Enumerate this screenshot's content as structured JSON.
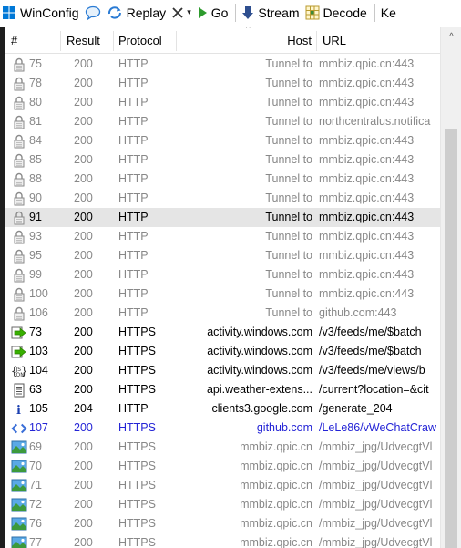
{
  "toolbar": {
    "items": [
      {
        "label": "WinConfig",
        "icon": "windows-logo-icon"
      },
      {
        "label": "",
        "icon": "comment-bubble-icon"
      },
      {
        "label": "Replay",
        "icon": "replay-arrows-icon"
      },
      {
        "label": "",
        "icon": "remove-x-icon",
        "dropdown": "▾"
      },
      {
        "label": "Go",
        "icon": "go-play-icon"
      },
      {
        "label": "Stream",
        "icon": "stream-down-arrow-icon"
      },
      {
        "label": "Decode",
        "icon": "decode-grid-icon"
      },
      {
        "label": "Ke",
        "icon": ""
      }
    ]
  },
  "columns": {
    "num": "#",
    "result": "Result",
    "protocol": "Protocol",
    "host": "Host",
    "url": "URL",
    "sort_indicator": "^"
  },
  "scrollbar": {
    "up_arrow": "^"
  },
  "colors": {
    "gray_text": "#888888",
    "blue_text": "#2424d6",
    "selected_row_bg": "#e5e5e5",
    "left_border": "#1e1e1e"
  },
  "rows": [
    {
      "icon": "lock-icon",
      "num": "75",
      "result": "200",
      "protocol": "HTTP",
      "host": "Tunnel to",
      "url": "mmbiz.qpic.cn:443",
      "style": "gray"
    },
    {
      "icon": "lock-icon",
      "num": "78",
      "result": "200",
      "protocol": "HTTP",
      "host": "Tunnel to",
      "url": "mmbiz.qpic.cn:443",
      "style": "gray"
    },
    {
      "icon": "lock-icon",
      "num": "80",
      "result": "200",
      "protocol": "HTTP",
      "host": "Tunnel to",
      "url": "mmbiz.qpic.cn:443",
      "style": "gray"
    },
    {
      "icon": "lock-icon",
      "num": "81",
      "result": "200",
      "protocol": "HTTP",
      "host": "Tunnel to",
      "url": "northcentralus.notifica",
      "style": "gray"
    },
    {
      "icon": "lock-icon",
      "num": "84",
      "result": "200",
      "protocol": "HTTP",
      "host": "Tunnel to",
      "url": "mmbiz.qpic.cn:443",
      "style": "gray"
    },
    {
      "icon": "lock-icon",
      "num": "85",
      "result": "200",
      "protocol": "HTTP",
      "host": "Tunnel to",
      "url": "mmbiz.qpic.cn:443",
      "style": "gray"
    },
    {
      "icon": "lock-icon",
      "num": "88",
      "result": "200",
      "protocol": "HTTP",
      "host": "Tunnel to",
      "url": "mmbiz.qpic.cn:443",
      "style": "gray"
    },
    {
      "icon": "lock-icon",
      "num": "90",
      "result": "200",
      "protocol": "HTTP",
      "host": "Tunnel to",
      "url": "mmbiz.qpic.cn:443",
      "style": "gray"
    },
    {
      "icon": "lock-icon",
      "num": "91",
      "result": "200",
      "protocol": "HTTP",
      "host": "Tunnel to",
      "url": "mmbiz.qpic.cn:443",
      "style": "black",
      "selected": true
    },
    {
      "icon": "lock-icon",
      "num": "93",
      "result": "200",
      "protocol": "HTTP",
      "host": "Tunnel to",
      "url": "mmbiz.qpic.cn:443",
      "style": "gray"
    },
    {
      "icon": "lock-icon",
      "num": "95",
      "result": "200",
      "protocol": "HTTP",
      "host": "Tunnel to",
      "url": "mmbiz.qpic.cn:443",
      "style": "gray"
    },
    {
      "icon": "lock-icon",
      "num": "99",
      "result": "200",
      "protocol": "HTTP",
      "host": "Tunnel to",
      "url": "mmbiz.qpic.cn:443",
      "style": "gray"
    },
    {
      "icon": "lock-icon",
      "num": "100",
      "result": "200",
      "protocol": "HTTP",
      "host": "Tunnel to",
      "url": "mmbiz.qpic.cn:443",
      "style": "gray"
    },
    {
      "icon": "lock-icon",
      "num": "106",
      "result": "200",
      "protocol": "HTTP",
      "host": "Tunnel to",
      "url": "github.com:443",
      "style": "gray"
    },
    {
      "icon": "green-arrow-icon",
      "num": "73",
      "result": "200",
      "protocol": "HTTPS",
      "host": "activity.windows.com",
      "url": "/v3/feeds/me/$batch",
      "style": "black"
    },
    {
      "icon": "green-arrow-icon",
      "num": "103",
      "result": "200",
      "protocol": "HTTPS",
      "host": "activity.windows.com",
      "url": "/v3/feeds/me/$batch",
      "style": "black"
    },
    {
      "icon": "json-braces-icon",
      "num": "104",
      "result": "200",
      "protocol": "HTTPS",
      "host": "activity.windows.com",
      "url": "/v3/feeds/me/views/b",
      "style": "black"
    },
    {
      "icon": "document-icon",
      "num": "63",
      "result": "200",
      "protocol": "HTTPS",
      "host": "api.weather-extens...",
      "url": "/current?location=&cit",
      "style": "black"
    },
    {
      "icon": "info-icon",
      "num": "105",
      "result": "204",
      "protocol": "HTTP",
      "host": "clients3.google.com",
      "url": "/generate_204",
      "style": "black"
    },
    {
      "icon": "code-brackets-icon",
      "num": "107",
      "result": "200",
      "protocol": "HTTPS",
      "host": "github.com",
      "url": "/LeLe86/vWeChatCraw",
      "style": "blue"
    },
    {
      "icon": "image-icon",
      "num": "69",
      "result": "200",
      "protocol": "HTTPS",
      "host": "mmbiz.qpic.cn",
      "url": "/mmbiz_jpg/UdvecgtVl",
      "style": "gray"
    },
    {
      "icon": "image-icon",
      "num": "70",
      "result": "200",
      "protocol": "HTTPS",
      "host": "mmbiz.qpic.cn",
      "url": "/mmbiz_jpg/UdvecgtVl",
      "style": "gray"
    },
    {
      "icon": "image-icon",
      "num": "71",
      "result": "200",
      "protocol": "HTTPS",
      "host": "mmbiz.qpic.cn",
      "url": "/mmbiz_jpg/UdvecgtVl",
      "style": "gray"
    },
    {
      "icon": "image-icon",
      "num": "72",
      "result": "200",
      "protocol": "HTTPS",
      "host": "mmbiz.qpic.cn",
      "url": "/mmbiz_jpg/UdvecgtVl",
      "style": "gray"
    },
    {
      "icon": "image-icon",
      "num": "76",
      "result": "200",
      "protocol": "HTTPS",
      "host": "mmbiz.qpic.cn",
      "url": "/mmbiz_jpg/UdvecgtVl",
      "style": "gray"
    },
    {
      "icon": "image-icon",
      "num": "77",
      "result": "200",
      "protocol": "HTTPS",
      "host": "mmbiz.qpic.cn",
      "url": "/mmbiz_jpg/UdvecgtVl",
      "style": "gray"
    }
  ]
}
